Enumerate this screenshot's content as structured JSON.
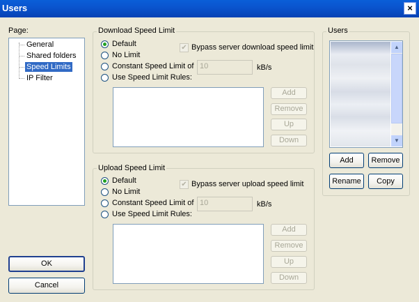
{
  "window": {
    "title": "Users",
    "close_glyph": "×"
  },
  "page_panel": {
    "label": "Page:",
    "items": [
      {
        "label": "General",
        "selected": false
      },
      {
        "label": "Shared folders",
        "selected": false
      },
      {
        "label": "Speed Limits",
        "selected": true
      },
      {
        "label": "IP Filter",
        "selected": false
      }
    ]
  },
  "download": {
    "group_title": "Download Speed Limit",
    "options": [
      {
        "label": "Default",
        "checked": true
      },
      {
        "label": "No Limit",
        "checked": false
      },
      {
        "label": "Constant Speed Limit of",
        "checked": false
      },
      {
        "label": "Use Speed Limit Rules:",
        "checked": false
      }
    ],
    "bypass_label": "Bypass server download speed limit",
    "bypass_checked": true,
    "limit_value": "10",
    "unit": "kB/s",
    "buttons": {
      "add": "Add",
      "remove": "Remove",
      "up": "Up",
      "down": "Down"
    }
  },
  "upload": {
    "group_title": "Upload Speed Limit",
    "options": [
      {
        "label": "Default",
        "checked": true
      },
      {
        "label": "No Limit",
        "checked": false
      },
      {
        "label": "Constant Speed Limit of",
        "checked": false
      },
      {
        "label": "Use Speed Limit Rules:",
        "checked": false
      }
    ],
    "bypass_label": "Bypass server upload speed limit",
    "bypass_checked": true,
    "limit_value": "10",
    "unit": "kB/s",
    "buttons": {
      "add": "Add",
      "remove": "Remove",
      "up": "Up",
      "down": "Down"
    }
  },
  "users": {
    "group_title": "Users",
    "buttons": {
      "add": "Add",
      "remove": "Remove",
      "rename": "Rename",
      "copy": "Copy"
    }
  },
  "footer": {
    "ok": "OK",
    "cancel": "Cancel"
  },
  "colors": {
    "titlebar": "#0a55cf",
    "selection": "#316ac5",
    "dialog_bg": "#ece9d8"
  },
  "icons": {
    "close": "close-icon",
    "radio_selected": "radio-dot-icon",
    "checkmark": "checkmark-icon",
    "scroll_up": "scroll-up-icon",
    "scroll_down": "scroll-down-icon"
  }
}
